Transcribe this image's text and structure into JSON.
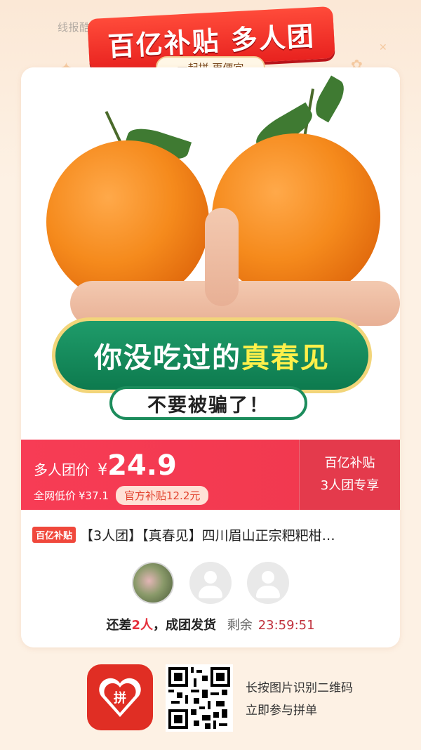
{
  "watermark": "线报酷-new.xianbao.fun",
  "banner": {
    "title": "百亿补贴 多人团",
    "subtitle": "一起拼 更便宜"
  },
  "product_image": {
    "headline_part1": "你没吃过的",
    "headline_highlight": "真春见",
    "subline": "不要被骗了！"
  },
  "price": {
    "label": "多人团价",
    "currency": "¥",
    "value": "24.9",
    "market_label": "全网低价",
    "market_price": "¥37.1",
    "subsidy": "官方补贴12.2元",
    "side_line1": "百亿补贴",
    "side_line2": "3人团专享"
  },
  "product": {
    "badge": "百亿补贴",
    "title": "【3人团】【真春见】四川眉山正宗粑粑柑…"
  },
  "group": {
    "prefix": "还差",
    "count": "2人",
    "suffix": "，成团发货",
    "remain_label": "剩余",
    "timer": "23:59:51"
  },
  "footer": {
    "app_logo_text": "拼",
    "line1": "长按图片识别二维码",
    "line2": "立即参与拼单"
  },
  "colors": {
    "accent": "#f73c55",
    "brand": "#e02e24",
    "promo_green": "#0d7a4e"
  }
}
